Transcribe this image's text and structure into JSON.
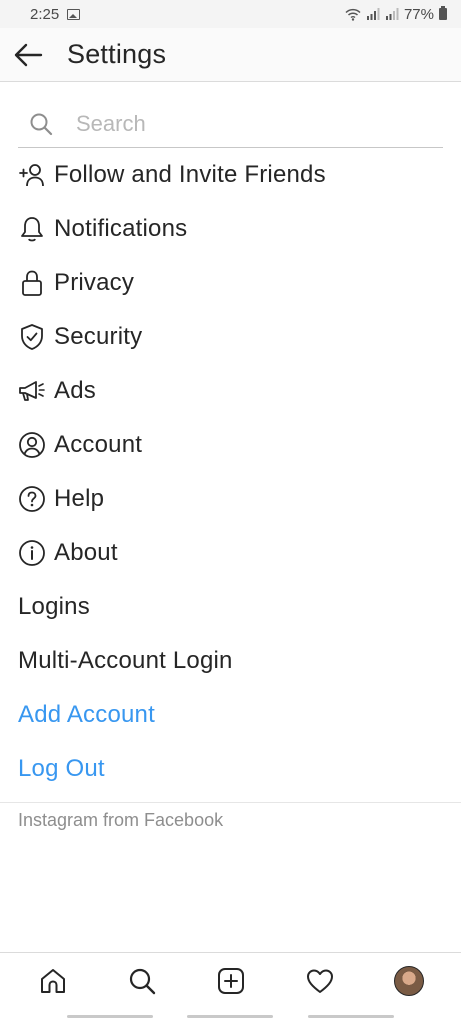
{
  "status_bar": {
    "time": "2:25",
    "battery": "77%"
  },
  "header": {
    "title": "Settings"
  },
  "search": {
    "placeholder": "Search"
  },
  "menu": [
    {
      "label": "Follow and Invite Friends",
      "icon": "add-person-icon"
    },
    {
      "label": "Notifications",
      "icon": "bell-icon"
    },
    {
      "label": "Privacy",
      "icon": "lock-icon"
    },
    {
      "label": "Security",
      "icon": "shield-icon"
    },
    {
      "label": "Ads",
      "icon": "megaphone-icon"
    },
    {
      "label": "Account",
      "icon": "account-icon"
    },
    {
      "label": "Help",
      "icon": "help-icon"
    },
    {
      "label": "About",
      "icon": "info-icon"
    },
    {
      "label": "Logins"
    },
    {
      "label": "Multi-Account Login"
    },
    {
      "label": "Add Account"
    },
    {
      "label": "Log Out"
    }
  ],
  "footer": {
    "text": "Instagram from Facebook"
  },
  "colors": {
    "link_blue": "#3897f0",
    "text": "#262626",
    "muted": "#8e8e8e"
  }
}
